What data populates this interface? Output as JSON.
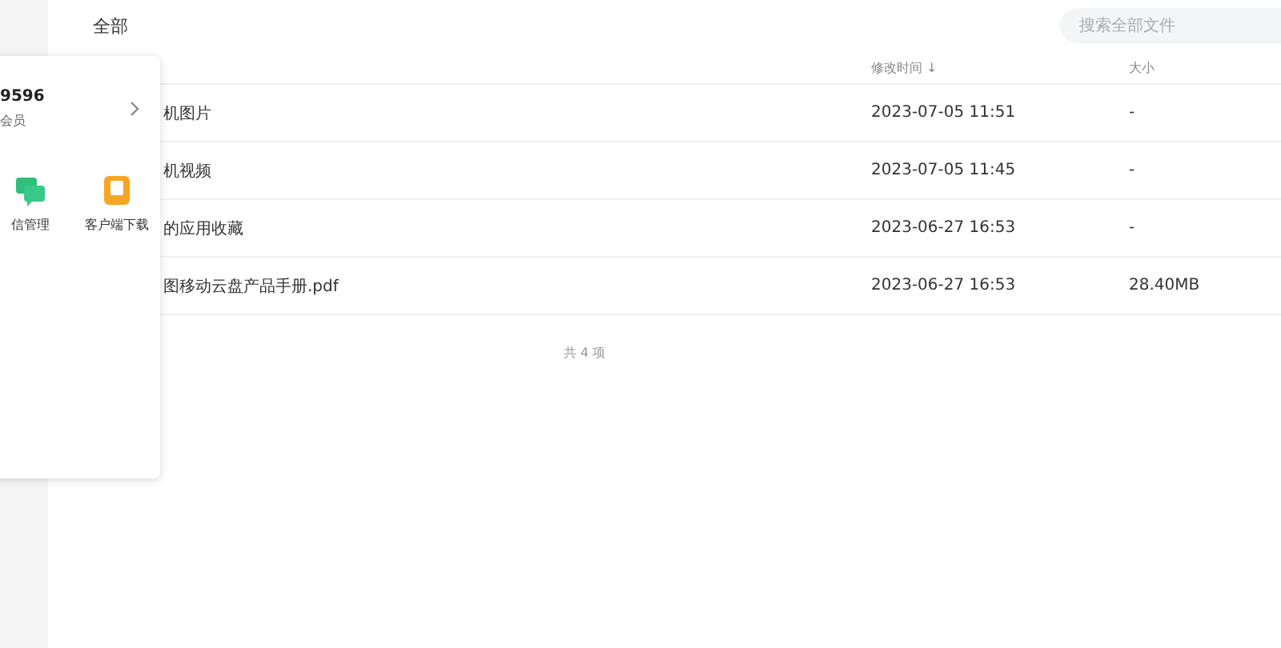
{
  "header": {
    "title": "全部",
    "search": {
      "placeholder": "搜索全部文件"
    }
  },
  "table": {
    "columns": [
      {
        "label": "修改时间 ↓"
      },
      {
        "label": "大小"
      }
    ],
    "rows": [
      {
        "name": "机图片",
        "modified": "2023-07-05  11:51",
        "size": "-"
      },
      {
        "name": "机视频",
        "modified": "2023-07-05  11:45",
        "size": "-"
      },
      {
        "name": "的应用收藏",
        "modified": "2023-06-27  16:53",
        "size": "-"
      },
      {
        "name": "图移动云盘产品手册.pdf",
        "modified": "2023-06-27  16:53",
        "size": "28.40MB"
      }
    ],
    "footer": "共 4 项"
  },
  "popup": {
    "account": "9596",
    "membership": "会员",
    "shortcuts": [
      {
        "kind": "chat",
        "label": "信管理"
      },
      {
        "kind": "download",
        "label": "客户端下载"
      }
    ]
  }
}
